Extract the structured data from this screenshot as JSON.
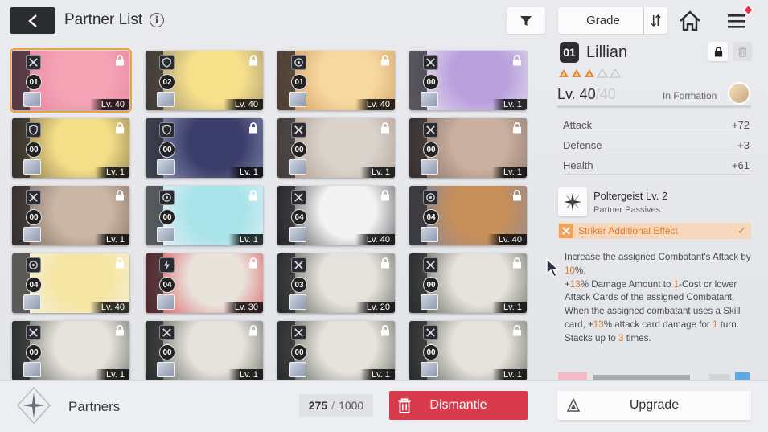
{
  "header": {
    "title": "Partner List",
    "sort_label": "Grade"
  },
  "cards": [
    {
      "rank": "01",
      "level": "Lv. 40",
      "class": "striker",
      "colors": [
        "#f4a3b5",
        "#e87a97"
      ],
      "selected": true
    },
    {
      "rank": "02",
      "level": "Lv. 40",
      "class": "defender",
      "colors": [
        "#f6e08a",
        "#8a8070"
      ]
    },
    {
      "rank": "01",
      "level": "Lv. 40",
      "class": "support",
      "colors": [
        "#f7d9a0",
        "#c98c53"
      ]
    },
    {
      "rank": "00",
      "level": "Lv. 1",
      "class": "striker",
      "colors": [
        "#b9a0dd",
        "#f2f0f6"
      ]
    },
    {
      "rank": "00",
      "level": "Lv. 1",
      "class": "defender",
      "colors": [
        "#f4df88",
        "#6c5a40"
      ]
    },
    {
      "rank": "00",
      "level": "Lv. 1",
      "class": "defender",
      "colors": [
        "#3b3e6b",
        "#9fa9c8"
      ]
    },
    {
      "rank": "00",
      "level": "Lv. 1",
      "class": "striker",
      "colors": [
        "#d9d3cc",
        "#a88b7a"
      ]
    },
    {
      "rank": "00",
      "level": "Lv. 1",
      "class": "striker",
      "colors": [
        "#c9b0a0",
        "#7c6055"
      ]
    },
    {
      "rank": "00",
      "level": "Lv. 1",
      "class": "striker",
      "colors": [
        "#cbb7a6",
        "#6e5a4c"
      ]
    },
    {
      "rank": "00",
      "level": "Lv. 1",
      "class": "support",
      "colors": [
        "#a9e3ea",
        "#f1f5f7"
      ]
    },
    {
      "rank": "04",
      "level": "Lv. 40",
      "class": "striker",
      "colors": [
        "#f3f3f3",
        "#2e2e33"
      ]
    },
    {
      "rank": "04",
      "level": "Lv. 40",
      "class": "support",
      "colors": [
        "#c78f5a",
        "#7b85a6"
      ]
    },
    {
      "rank": "04",
      "level": "Lv. 40",
      "class": "support",
      "colors": [
        "#f6e6a3",
        "#f3f3f3"
      ]
    },
    {
      "rank": "04",
      "level": "Lv. 30",
      "class": "lightning",
      "colors": [
        "#e9e3dc",
        "#d8343a"
      ]
    },
    {
      "rank": "03",
      "level": "Lv. 20",
      "class": "striker",
      "colors": [
        "#e6e2dc",
        "#3f4a3f"
      ]
    },
    {
      "rank": "00",
      "level": "Lv. 1",
      "class": "striker",
      "colors": [
        "#e6e2dc",
        "#3f4a3f"
      ]
    },
    {
      "rank": "00",
      "level": "Lv. 1",
      "class": "striker",
      "colors": [
        "#e6e2dc",
        "#3f4a3f"
      ]
    },
    {
      "rank": "00",
      "level": "Lv. 1",
      "class": "striker",
      "colors": [
        "#e6e2dc",
        "#3f4a3f"
      ]
    },
    {
      "rank": "00",
      "level": "Lv. 1",
      "class": "striker",
      "colors": [
        "#e6e2dc",
        "#3f4a3f"
      ]
    },
    {
      "rank": "00",
      "level": "Lv. 1",
      "class": "striker",
      "colors": [
        "#e6e2dc",
        "#3f4a3f"
      ]
    }
  ],
  "detail": {
    "rank": "01",
    "name": "Lillian",
    "stars_filled": 3,
    "stars_total": 5,
    "level_current": "Lv. 40",
    "level_sep": "/",
    "level_max": "40",
    "formation_label": "In Formation",
    "stats": [
      {
        "name": "Attack",
        "value": "+72"
      },
      {
        "name": "Defense",
        "value": "+3"
      },
      {
        "name": "Health",
        "value": "+61"
      }
    ],
    "passive_name": "Poltergeist Lv. 2",
    "passive_sub": "Partner Passives",
    "effect_label": "Striker Additional Effect",
    "desc": {
      "p1a": "Increase the assigned Combatant's Attack by ",
      "p1b": "10",
      "p1c": "%.",
      "p2a": "+",
      "p2b": "13",
      "p2c": "% Damage Amount to ",
      "p2d": "1",
      "p2e": "-Cost or lower Attack Cards of the assigned Combatant.",
      "p3a": "When the assigned combatant uses a Skill card, +",
      "p3b": "13",
      "p3c": "% attack card damage for ",
      "p3d": "1",
      "p3e": " turn. Stacks up to ",
      "p3f": "3",
      "p3g": " times."
    }
  },
  "footer": {
    "section_label": "Partners",
    "count_current": "275",
    "count_sep": "/",
    "count_max": "1000",
    "dismantle_label": "Dismantle",
    "upgrade_label": "Upgrade"
  },
  "colors": {
    "accent_orange": "#e37b21",
    "dismantle_red": "#d83c4c",
    "selected_outline": "#e8a34a"
  }
}
